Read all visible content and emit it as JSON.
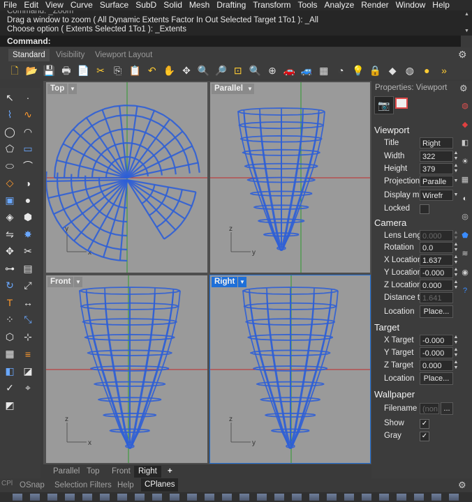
{
  "menu": [
    "File",
    "Edit",
    "View",
    "Curve",
    "Surface",
    "SubD",
    "Solid",
    "Mesh",
    "Drafting",
    "Transform",
    "Tools",
    "Analyze",
    "Render",
    "Window",
    "Help"
  ],
  "command": {
    "history": [
      "Command: _Zoom",
      "Drag a window to zoom ( All  Dynamic  Extents  Factor  In  Out  Selected  Target  1To1 ): _All",
      "Choose option ( Extents  Selected  1To1 ): _Extents"
    ],
    "prompt": "Command:"
  },
  "toolbar_tabs": [
    "Standard",
    "Visibility",
    "Viewport Layout"
  ],
  "toolbar_icons": [
    "new-icon",
    "open-icon",
    "save-icon",
    "print-icon",
    "properties-icon",
    "cut-icon",
    "copy-icon",
    "paste-icon",
    "undo-icon",
    "pan-icon",
    "rotate-view-icon",
    "zoom-icon",
    "zoom-window-icon",
    "zoom-extents-icon",
    "zoom-selected-icon",
    "zoom-all-icon",
    "car-icon",
    "car2-icon",
    "cplane-icon",
    "camera-icon",
    "light-icon",
    "lock-icon",
    "render-icon",
    "color-wheel-icon",
    "sphere-icon",
    "more-icon"
  ],
  "left_tools": [
    "select-icon",
    "point-icon",
    "polyline-icon",
    "curve-icon",
    "circle-icon",
    "arc-icon",
    "polygon-icon",
    "rectangle-icon",
    "ellipse-icon",
    "fillet-icon",
    "surface-icon",
    "revolve-icon",
    "box-icon",
    "sphere-icon",
    "solid-edit-icon",
    "mesh-icon",
    "mirror-icon",
    "explode-icon",
    "move-icon",
    "trim-icon",
    "join-icon",
    "group-icon",
    "rotate-icon",
    "scale-icon",
    "text-icon",
    "dimension-icon",
    "array-icon",
    "transform-icon",
    "box3d-icon",
    "gumball-icon",
    "grid-icon",
    "layer-icon",
    "color-icon",
    "material-icon",
    "check-icon",
    "analyze-icon",
    "render-mesh-icon"
  ],
  "viewports": {
    "top": {
      "label": "Top"
    },
    "parallel": {
      "label": "Parallel"
    },
    "front": {
      "label": "Front"
    },
    "right": {
      "label": "Right"
    }
  },
  "axes": {
    "x": "x",
    "y": "y",
    "z": "z"
  },
  "viewport_tabs": [
    "Parallel",
    "Top",
    "Front",
    "Right",
    "+"
  ],
  "properties": {
    "header": "Properties: Viewport",
    "viewport_section": "Viewport",
    "title_label": "Title",
    "title_value": "Right",
    "width_label": "Width",
    "width_value": "322",
    "height_label": "Height",
    "height_value": "379",
    "projection_label": "Projection",
    "projection_value": "Paralle",
    "display_label": "Display m",
    "display_value": "Wirefr",
    "locked_label": "Locked",
    "camera_section": "Camera",
    "lens_label": "Lens Leng",
    "lens_value": "0.000",
    "rotation_label": "Rotation",
    "rotation_value": "0.0",
    "xloc_label": "X Location",
    "xloc_value": "1.637",
    "yloc_label": "Y Location",
    "yloc_value": "-0.000",
    "zloc_label": "Z Location",
    "zloc_value": "0.000",
    "dist_label": "Distance t",
    "dist_value": "1.641",
    "location_label": "Location",
    "location_btn": "Place...",
    "target_section": "Target",
    "xtarget_label": "X Target",
    "xtarget_value": "-0.000",
    "ytarget_label": "Y Target",
    "ytarget_value": "-0.000",
    "ztarget_label": "Z Target",
    "ztarget_value": "0.000",
    "tlocation_label": "Location",
    "tlocation_btn": "Place...",
    "wallpaper_section": "Wallpaper",
    "filename_label": "Filename",
    "filename_value": "(non",
    "filename_btn": "...",
    "show_label": "Show",
    "gray_label": "Gray",
    "check": "✓"
  },
  "status_tabs": [
    "OSnap",
    "Selection Filters",
    "Help",
    "CPlanes"
  ],
  "cpl": "CPl",
  "colors": {
    "wire": "#2f5fd6",
    "wire_light": "#5b86f0",
    "grid_red": "#c22a2a",
    "grid_green": "#2e9a2e",
    "active_blue": "#1e6fd8"
  }
}
